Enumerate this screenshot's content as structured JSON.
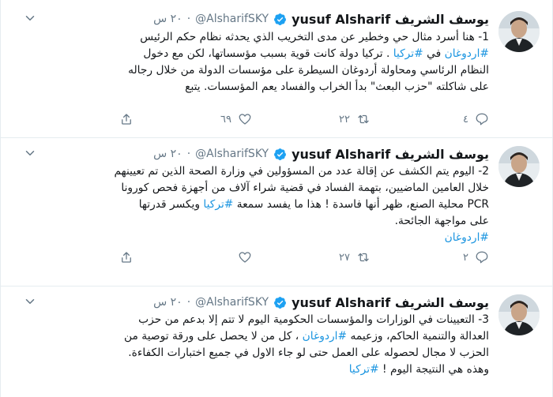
{
  "tweets": [
    {
      "author_name": "yusuf Alsharif يوسف الشريف",
      "handle": "@AlsharifSKY",
      "dot": "·",
      "time": "٢٠ س",
      "text_lines": [
        "1- هنا أسرد مثال حي وخطير عن مدى التخريب الذي يحدثه نظام حكم الرئيس",
        "#اردوغان في #تركيا . تركيا دولة كانت قوية بسبب مؤسساتها، لكن مع دخول",
        "النظام الرئاسي ومحاولة أردوغان السيطرة على مؤسسات الدولة من خلال رجاله",
        "على شاكلته \"حزب البعث\" بدأ الخراب والفساد يعم المؤسسات. يتبع"
      ],
      "replies": "٤",
      "retweets": "٢٢",
      "likes": "٦٩"
    },
    {
      "author_name": "yusuf Alsharif يوسف الشريف",
      "handle": "@AlsharifSKY",
      "dot": "·",
      "time": "٢٠ س",
      "text_lines": [
        "2- اليوم يتم الكشف عن إقالة عدد من المسؤولين في وزارة الصحة الذين تم تعيينهم",
        "خلال العامين الماضيين، بتهمة الفساد في قضية شراء آلاف من أجهزة فحص كورونا",
        "PCR محلية الصنع، ظهر أنها فاسدة ! هذا ما يفسد سمعة #تركيا ويكسر قدرتها",
        "على مواجهة الجائحة.",
        "#اردوغان"
      ],
      "replies": "٢",
      "retweets": "٢٧",
      "likes": ""
    },
    {
      "author_name": "yusuf Alsharif يوسف الشريف",
      "handle": "@AlsharifSKY",
      "dot": "·",
      "time": "٢٠ س",
      "text_lines": [
        "3- التعيينات في الوزارات والمؤسسات الحكومية اليوم لا تتم إلا بدعم من حزب",
        "العدالة والتنمية الحاكم، وزعيمه #اردوغان ، كل من لا يحصل على ورقة توصية من",
        "الحزب لا مجال لحصوله على العمل حتى لو جاء الاول في جميع اختبارات الكفاءة.",
        "وهذه هي النتيجة اليوم ! #تركيا"
      ]
    }
  ],
  "colors": {
    "text": "#14171a",
    "muted": "#657786",
    "link": "#1b95e0",
    "verified": "#1da1f2",
    "border": "#e6ecf0"
  },
  "icons": [
    "avatar",
    "verified-badge-icon",
    "caret-down-icon",
    "reply-icon",
    "retweet-icon",
    "like-icon",
    "share-icon"
  ]
}
